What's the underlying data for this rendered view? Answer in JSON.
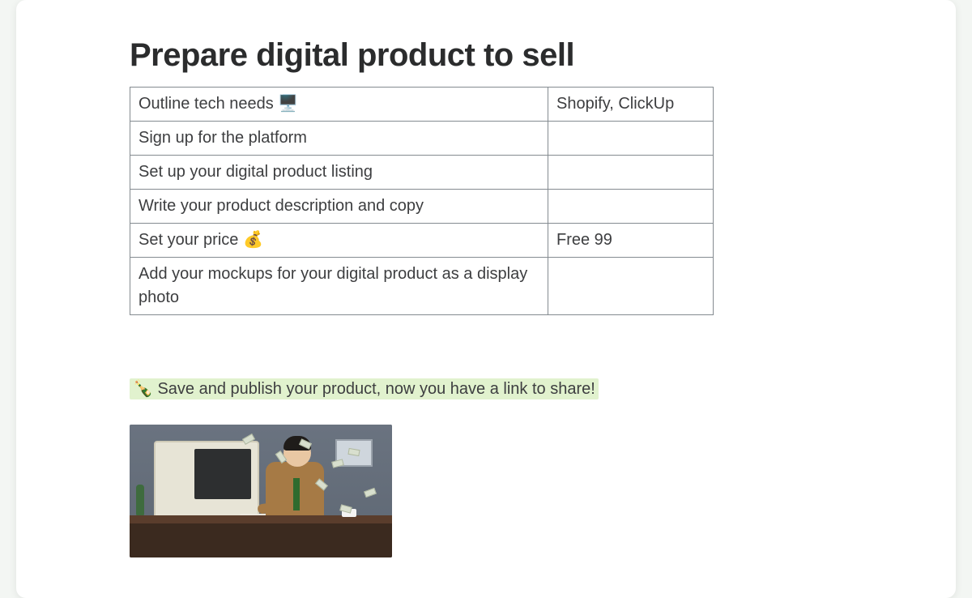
{
  "title": "Prepare digital product to sell",
  "table": {
    "rows": [
      {
        "task": "Outline tech needs 🖥️",
        "value": "Shopify, ClickUp"
      },
      {
        "task": "Sign up for the platform",
        "value": ""
      },
      {
        "task": "Set up your digital product listing",
        "value": ""
      },
      {
        "task": "Write your product description and copy",
        "value": ""
      },
      {
        "task": "Set your price 💰",
        "value": "Free 99"
      },
      {
        "task": "Add your mockups for your digital product as a display photo",
        "value": ""
      }
    ]
  },
  "highlight": {
    "emoji": "🍾",
    "text": "Save and publish your product, now you have a link to share!"
  },
  "embed": {
    "description": "Animated image of a man in a tan suit typing at a beige CRT computer while paper money flies around him"
  }
}
